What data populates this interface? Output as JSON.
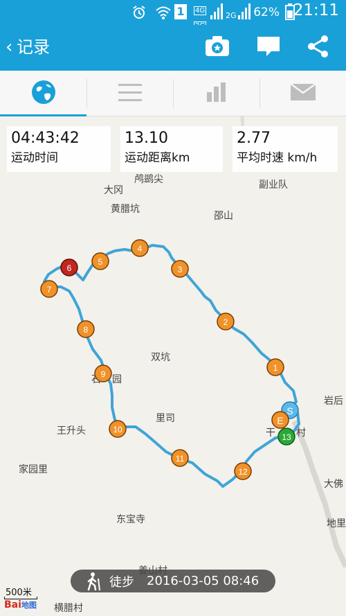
{
  "status_bar": {
    "sim_slot": "1",
    "net_4g": "4G",
    "net_2g_a": "2G",
    "net_2g_b": "2G",
    "battery_percent": "62%",
    "time": "21:11"
  },
  "app_bar": {
    "back_glyph": "‹",
    "title": "记录"
  },
  "tabs": [
    {
      "name": "map",
      "icon": "globe-icon",
      "active": true
    },
    {
      "name": "list",
      "icon": "list-icon",
      "active": false
    },
    {
      "name": "stats",
      "icon": "bar-chart-icon",
      "active": false
    },
    {
      "name": "message",
      "icon": "mail-icon",
      "active": false
    }
  ],
  "stats": {
    "time": {
      "value": "04:43:42",
      "label": "运动时间"
    },
    "distance": {
      "value": "13.10",
      "label": "运动距离km"
    },
    "speed": {
      "value": "2.77",
      "label": "平均时速 km/h"
    }
  },
  "places": [
    {
      "name": "鸬鹚尖"
    },
    {
      "name": "大冈"
    },
    {
      "name": "副业队"
    },
    {
      "name": "黄腊坑"
    },
    {
      "name": "邵山"
    },
    {
      "name": "双坑"
    },
    {
      "name": "石"
    },
    {
      "name": "园"
    },
    {
      "name": "岩后"
    },
    {
      "name": "王升头"
    },
    {
      "name": "里司"
    },
    {
      "name": "干"
    },
    {
      "name": "村"
    },
    {
      "name": "家园里"
    },
    {
      "name": "大佛"
    },
    {
      "name": "东宝寺"
    },
    {
      "name": "地里"
    },
    {
      "name": "姜山村"
    },
    {
      "name": "横腊村"
    }
  ],
  "markers": [
    {
      "label": "1",
      "color": "orange"
    },
    {
      "label": "2",
      "color": "orange"
    },
    {
      "label": "3",
      "color": "orange"
    },
    {
      "label": "4",
      "color": "orange"
    },
    {
      "label": "5",
      "color": "orange"
    },
    {
      "label": "6",
      "color": "red"
    },
    {
      "label": "7",
      "color": "orange"
    },
    {
      "label": "8",
      "color": "orange"
    },
    {
      "label": "9",
      "color": "orange"
    },
    {
      "label": "10",
      "color": "orange"
    },
    {
      "label": "11",
      "color": "orange"
    },
    {
      "label": "12",
      "color": "orange"
    },
    {
      "label": "13",
      "color": "green"
    },
    {
      "label": "S",
      "color": "blue"
    },
    {
      "label": "E",
      "color": "orange"
    }
  ],
  "activity": {
    "mode": "徒步",
    "datetime": "2016-03-05 08:46",
    "icon": "hiker-icon"
  },
  "scale": "500米",
  "map_brand_left": "Bai",
  "map_brand_right": "地图",
  "colors": {
    "primary": "#1aa0d8",
    "route": "#3fa4d8",
    "marker_orange": "#f0922a",
    "marker_red": "#c0281f",
    "marker_green": "#2aa838",
    "marker_blue": "#5bb8e8"
  }
}
